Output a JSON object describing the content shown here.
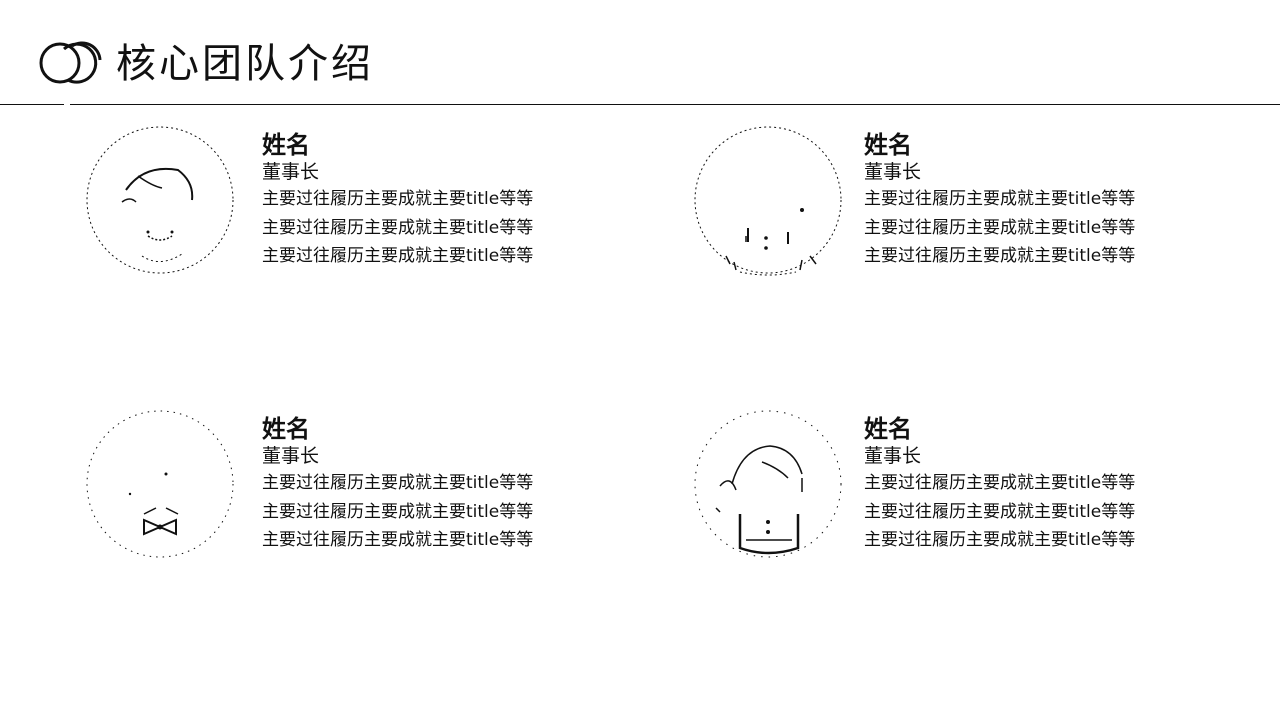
{
  "header": {
    "title": "核心团队介绍",
    "logo_icon": "overlapping-circles-logo"
  },
  "members": [
    {
      "avatar_icon": "female-avatar-icon",
      "name": "姓名",
      "role": "董事长",
      "lines": [
        "主要过往履历主要成就主要title等等",
        "主要过往履历主要成就主要title等等",
        "主要过往履历主要成就主要title等等"
      ]
    },
    {
      "avatar_icon": "male-suit-avatar-icon",
      "name": "姓名",
      "role": "董事长",
      "lines": [
        "主要过往履历主要成就主要title等等",
        "主要过往履历主要成就主要title等等",
        "主要过往履历主要成就主要title等等"
      ]
    },
    {
      "avatar_icon": "bowtie-avatar-icon",
      "name": "姓名",
      "role": "董事长",
      "lines": [
        "主要过往履历主要成就主要title等等",
        "主要过往履历主要成就主要title等等",
        "主要过往履历主要成就主要title等等"
      ]
    },
    {
      "avatar_icon": "girl-avatar-icon",
      "name": "姓名",
      "role": "董事长",
      "lines": [
        "主要过往履历主要成就主要title等等",
        "主要过往履历主要成就主要title等等",
        "主要过往履历主要成就主要title等等"
      ]
    }
  ]
}
